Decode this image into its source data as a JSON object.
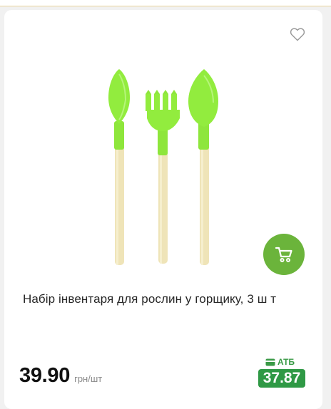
{
  "product": {
    "title": "Набір інвентаря для рослин у горщику, 3 ш т",
    "image_icon": "garden-tools-set-icon"
  },
  "favorite": {
    "icon": "heart-outline-icon",
    "active": false
  },
  "cart": {
    "icon": "shopping-cart-icon"
  },
  "price": {
    "value": "39.90",
    "unit": "грн/шт"
  },
  "loyalty": {
    "label": "АТБ",
    "icon": "card-icon",
    "price": "37.87"
  },
  "colors": {
    "accent_green": "#6bb43b",
    "atb_green": "#2f9945",
    "tool_green": "#8ee63c"
  }
}
